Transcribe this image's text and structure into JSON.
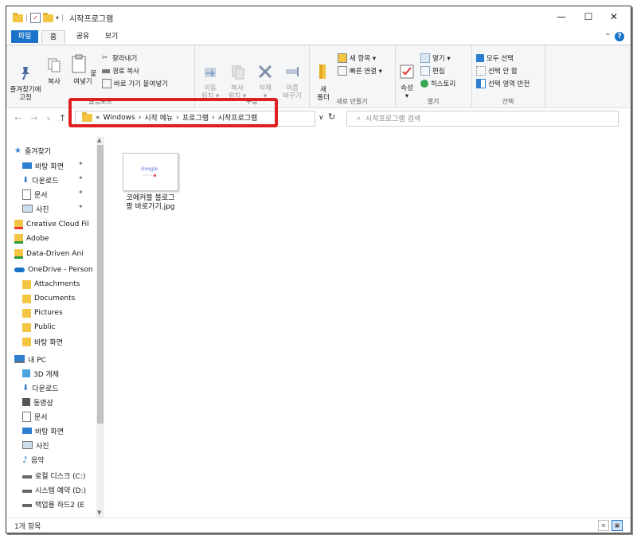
{
  "window": {
    "title": "시작프로그램",
    "minimize": "—",
    "maximize": "☐",
    "close": "✕"
  },
  "tabs": {
    "file": "파일",
    "home": "홈",
    "share": "공유",
    "view": "보기"
  },
  "ribbon": {
    "clipboard": {
      "label": "클립보드",
      "pin": "즐겨찾기에\n고정",
      "copy": "복사",
      "paste": "붙여넣기",
      "cut": "잘라내기",
      "copy_path": "경로 복사",
      "paste_shortcut": "바로 가기 붙여넣기"
    },
    "organize": {
      "label": "구성",
      "move_to": "이동\n위치 ▾",
      "copy_to": "복사\n위치 ▾",
      "delete": "삭제\n▾",
      "rename": "이름\n바꾸기"
    },
    "new": {
      "label": "새로 만들기",
      "new_folder": "새\n폴더",
      "new_item": "새 항목 ▾",
      "easy_access": "빠른 연결 ▾"
    },
    "open": {
      "label": "열기",
      "properties": "속성\n▾",
      "open": "열기 ▾",
      "edit": "편집",
      "history": "히스토리"
    },
    "select": {
      "label": "선택",
      "select_all": "모두 선택",
      "select_none": "선택 안 함",
      "invert": "선택 영역 반전"
    }
  },
  "address": {
    "prefix": "«",
    "crumbs": [
      "Windows",
      "시작 메뉴",
      "프로그램",
      "시작프로그램"
    ],
    "sep": "›"
  },
  "search": {
    "placeholder": "시작프로그램 검색"
  },
  "nav": [
    {
      "label": "즐겨찾기",
      "icon": "star-icon",
      "indent": 0,
      "pin": false
    },
    {
      "label": "바탕 화면",
      "icon": "desktop-icon",
      "indent": 1,
      "pin": true
    },
    {
      "label": "다운로드",
      "icon": "download-icon",
      "indent": 1,
      "pin": true
    },
    {
      "label": "문서",
      "icon": "document-icon",
      "indent": 1,
      "pin": true
    },
    {
      "label": "사진",
      "icon": "picture-icon",
      "indent": 1,
      "pin": true
    },
    {
      "label": "Creative Cloud Fil",
      "icon": "creative-cloud-icon",
      "indent": 0,
      "pin": false
    },
    {
      "label": "Adobe",
      "icon": "adobe-folder-icon",
      "indent": 0,
      "pin": false
    },
    {
      "label": "Data-Driven Ani",
      "icon": "adobe-folder-icon",
      "indent": 0,
      "pin": false
    },
    {
      "label": "OneDrive - Person",
      "icon": "onedrive-icon",
      "indent": 0,
      "pin": false
    },
    {
      "label": "Attachments",
      "icon": "folder-icon",
      "indent": 1,
      "pin": false
    },
    {
      "label": "Documents",
      "icon": "folder-icon",
      "indent": 1,
      "pin": false
    },
    {
      "label": "Pictures",
      "icon": "folder-icon",
      "indent": 1,
      "pin": false
    },
    {
      "label": "Public",
      "icon": "folder-icon",
      "indent": 1,
      "pin": false
    },
    {
      "label": "바탕 화면",
      "icon": "folder-icon",
      "indent": 1,
      "pin": false
    },
    {
      "label": "내 PC",
      "icon": "pc-icon",
      "indent": 0,
      "pin": false
    },
    {
      "label": "3D 개체",
      "icon": "3d-objects-icon",
      "indent": 1,
      "pin": false
    },
    {
      "label": "다운로드",
      "icon": "download-icon",
      "indent": 1,
      "pin": false
    },
    {
      "label": "동영상",
      "icon": "video-icon",
      "indent": 1,
      "pin": false
    },
    {
      "label": "문서",
      "icon": "document-icon",
      "indent": 1,
      "pin": false
    },
    {
      "label": "바탕 화면",
      "icon": "desktop-icon",
      "indent": 1,
      "pin": false
    },
    {
      "label": "사진",
      "icon": "picture-icon",
      "indent": 1,
      "pin": false
    },
    {
      "label": "음악",
      "icon": "music-icon",
      "indent": 1,
      "pin": false
    },
    {
      "label": "로컬 디스크 (C:)",
      "icon": "drive-icon",
      "indent": 1,
      "pin": false
    },
    {
      "label": "시스템 예약 (D:)",
      "icon": "drive-icon",
      "indent": 1,
      "pin": false
    },
    {
      "label": "백업용 하드2 (E",
      "icon": "drive-icon",
      "indent": 1,
      "pin": false
    }
  ],
  "files": [
    {
      "name_line1": "코에커블 블로그",
      "name_line2": "팡 바로가기.jpg",
      "thumb_text": "Google"
    }
  ],
  "status": {
    "count": "1개 항목"
  },
  "colors": {
    "accent": "#1a73c9",
    "highlight": "#e02020",
    "folder": "#f4c542"
  }
}
